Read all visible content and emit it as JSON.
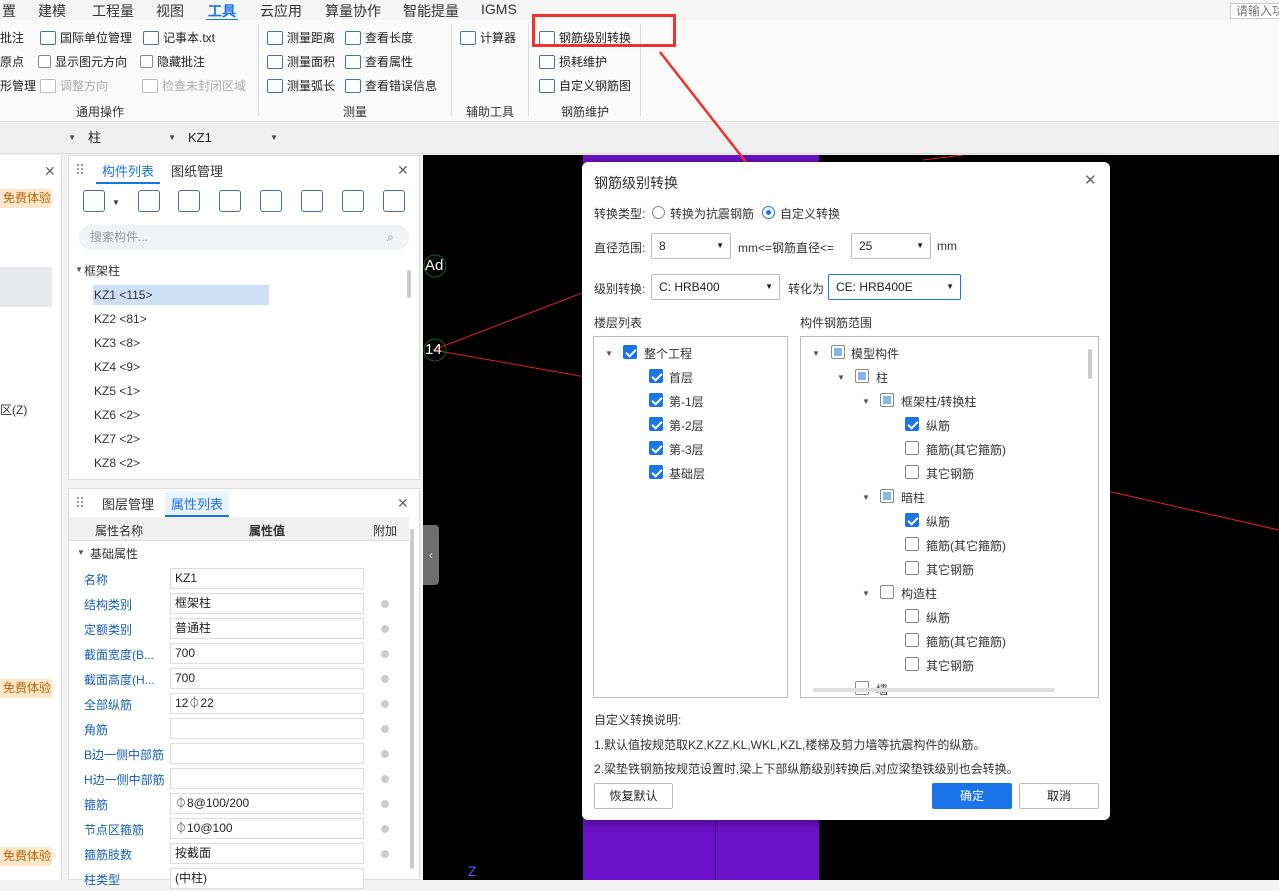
{
  "menu": {
    "items": [
      "置",
      "建模",
      "工程量",
      "视图",
      "工具",
      "云应用",
      "算量协作",
      "智能提量",
      "IGMS"
    ],
    "active": "工具",
    "search_placeholder": "请输入功"
  },
  "ribbon": {
    "general": {
      "items": [
        "批注",
        "国际单位管理",
        "记事本.txt",
        "原点",
        "显示图元方向",
        "隐藏批注",
        "形管理",
        "调整方向",
        "检查未封闭区域"
      ],
      "group_label": "通用操作"
    },
    "measure": {
      "items": [
        "测量距离",
        "查看长度",
        "测量面积",
        "查看属性",
        "测量弧长",
        "查看错误信息"
      ],
      "group_label": "测量"
    },
    "aux": {
      "items": [
        "计算器"
      ],
      "group_label": "辅助工具"
    },
    "rebar": {
      "items": [
        "钢筋级别转换",
        "损耗维护",
        "自定义钢筋图"
      ],
      "group_label": "钢筋维护"
    }
  },
  "toolbar2": {
    "type_value": "柱",
    "component_value": "KZ1"
  },
  "left_badges": [
    "免费体验",
    "免费体验",
    "免费体验"
  ],
  "left_fragment": "区(Z)",
  "component_panel": {
    "tabs": [
      "构件列表",
      "图纸管理"
    ],
    "search_placeholder": "搜索构件...",
    "group": "框架柱",
    "items": [
      "KZ1 <115>",
      "KZ2 <81>",
      "KZ3 <8>",
      "KZ4 <9>",
      "KZ5 <1>",
      "KZ6 <2>",
      "KZ7 <2>",
      "KZ8 <2>"
    ]
  },
  "property_panel": {
    "tabs": [
      "图层管理",
      "属性列表"
    ],
    "headers": [
      "属性名称",
      "属性值",
      "附加"
    ],
    "section": "基础属性",
    "rows": [
      {
        "name": "名称",
        "value": "KZ1"
      },
      {
        "name": "结构类别",
        "value": "框架柱"
      },
      {
        "name": "定额类别",
        "value": "普通柱"
      },
      {
        "name": "截面宽度(B...",
        "value": "700"
      },
      {
        "name": "截面高度(H...",
        "value": "700"
      },
      {
        "name": "全部纵筋",
        "value": "12⏀22"
      },
      {
        "name": "角筋",
        "value": ""
      },
      {
        "name": "B边一侧中部筋",
        "value": ""
      },
      {
        "name": "H边一侧中部筋",
        "value": ""
      },
      {
        "name": "箍筋",
        "value": "⏀8@100/200"
      },
      {
        "name": "节点区箍筋",
        "value": "⏀10@100"
      },
      {
        "name": "箍筋肢数",
        "value": "按截面"
      },
      {
        "name": "柱类型",
        "value": "(中柱)"
      }
    ]
  },
  "canvas": {
    "labels": [
      "Ad",
      "14",
      "Z"
    ]
  },
  "dialog": {
    "title": "钢筋级别转换",
    "type_label": "转换类型:",
    "type_options": [
      "转换为抗震钢筋",
      "自定义转换"
    ],
    "type_selected": "自定义转换",
    "diameter_label": "直径范围:",
    "diameter_min": "8",
    "diameter_mid": "mm<=钢筋直径<=",
    "diameter_max": "25",
    "diameter_unit": "mm",
    "grade_label": "级别转换:",
    "grade_from": "C: HRB400",
    "grade_to_label": "转化为",
    "grade_to": "CE: HRB400E",
    "floor_list_label": "楼层列表",
    "floors": {
      "root": "整个工程",
      "items": [
        "首层",
        "第-1层",
        "第-2层",
        "第-3层",
        "基础层"
      ]
    },
    "range_label": "构件钢筋范围",
    "range_tree": {
      "root": "模型构件",
      "column": "柱",
      "groups": [
        {
          "name": "框架柱/转换柱",
          "items": [
            "纵筋",
            "箍筋(其它箍筋)",
            "其它钢筋"
          ],
          "checked": [
            true,
            false,
            false
          ]
        },
        {
          "name": "暗柱",
          "items": [
            "纵筋",
            "箍筋(其它箍筋)",
            "其它钢筋"
          ],
          "checked": [
            true,
            false,
            false
          ]
        },
        {
          "name": "构造柱",
          "items": [
            "纵筋",
            "箍筋(其它箍筋)",
            "其它钢筋"
          ],
          "checked": [
            false,
            false,
            false
          ]
        }
      ],
      "next_partial": "墙"
    },
    "notes_title": "自定义转换说明:",
    "notes": [
      "1.默认值按规范取KZ,KZZ,KL,WKL,KZL,楼梯及剪力墙等抗震构件的纵筋。",
      "2.梁垫铁钢筋按规范设置时,梁上下部纵筋级别转换后,对应梁垫铁级别也会转换。"
    ],
    "btn_restore": "恢复默认",
    "btn_ok": "确定",
    "btn_cancel": "取消"
  },
  "colors": {
    "accent": "#1a73e8",
    "highlight": "#f0312d",
    "canvas_bg": "#000000",
    "purple": "#6b11c9"
  }
}
